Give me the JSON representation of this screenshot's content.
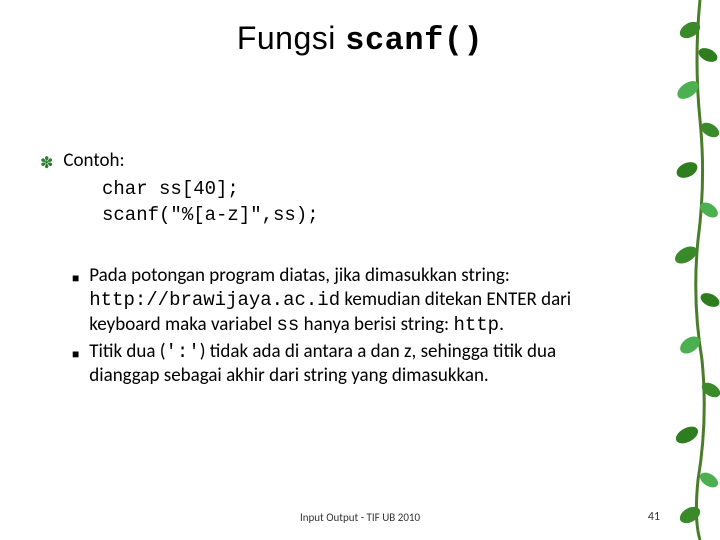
{
  "title": {
    "word": "Fungsi ",
    "code": "scanf()"
  },
  "example": {
    "label": "Contoh:",
    "line1": "char ss[40];",
    "line2": "scanf(\"%[a-z]\",ss);"
  },
  "para1": {
    "t1": "Pada potongan program diatas, jika dimasukkan string: ",
    "c1": "http://brawijaya.ac.id",
    "t2": " kemudian ditekan ENTER dari keyboard maka variabel ",
    "c2": "ss",
    "t3": " hanya berisi string: ",
    "c3": "http",
    "t4": "."
  },
  "para2": {
    "t1": "Titik dua (",
    "c1": "':'",
    "t2": ") tidak ada di antara a dan z, sehingga titik dua dianggap sebagai akhir dari string yang dimasukkan."
  },
  "footer": "Input Output - TIF UB 2010",
  "page": "41"
}
